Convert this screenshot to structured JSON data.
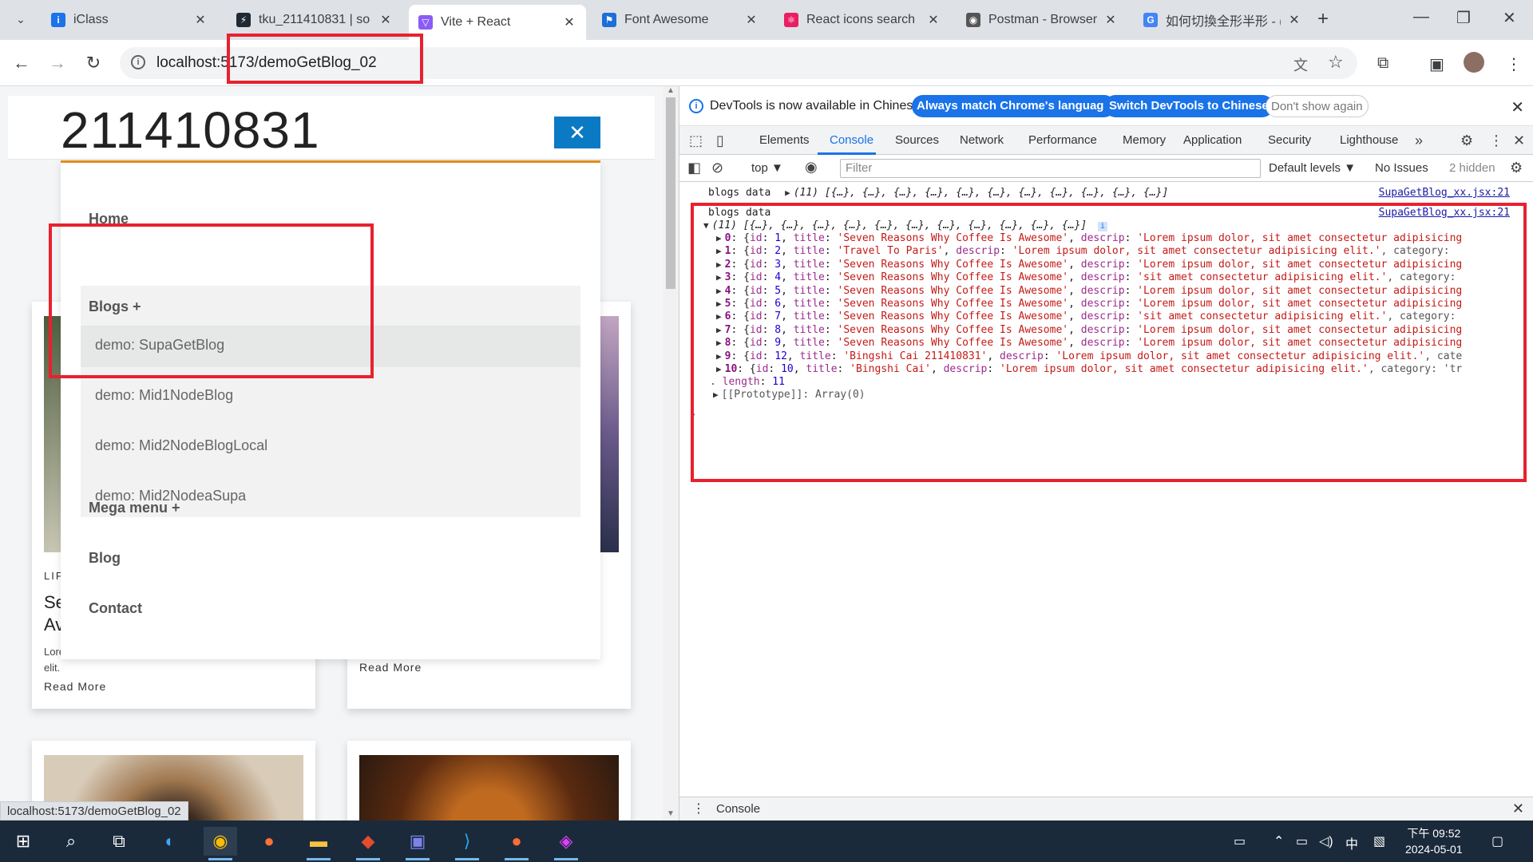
{
  "browser": {
    "tabs": [
      {
        "title": "iClass",
        "favicon_color": "#1a73e8",
        "favicon_char": "i",
        "active": false
      },
      {
        "title": "tku_211410831 | so",
        "favicon_color": "#1f2a33",
        "favicon_char": "⚡",
        "active": false
      },
      {
        "title": "Vite + React",
        "favicon_color": "#8a5cf6",
        "favicon_char": "▽",
        "active": true
      },
      {
        "title": "Font Awesome",
        "favicon_color": "#1d6fd6",
        "favicon_char": "⚑",
        "active": false
      },
      {
        "title": "React icons search",
        "favicon_color": "#e91e63",
        "favicon_char": "⚛",
        "active": false
      },
      {
        "title": "Postman - Browser",
        "favicon_color": "#555555",
        "favicon_char": "◉",
        "active": false
      },
      {
        "title": "如何切換全形半形 - (",
        "favicon_color": "#4285f4",
        "favicon_char": "G",
        "active": false
      }
    ],
    "new_tab_icon": "plus-icon",
    "url": "localhost:5173/demoGetBlog_02"
  },
  "page": {
    "site_title": "211410831",
    "close_symbol": "✕",
    "menu": {
      "items": [
        {
          "label": "Home"
        },
        {
          "label": "Blogs +"
        },
        {
          "label": "Mega menu +"
        },
        {
          "label": "Blog"
        },
        {
          "label": "Contact"
        }
      ],
      "blogs_submenu": [
        {
          "label": "demo: SupaGetBlog"
        },
        {
          "label": "demo: Mid1NodeBlog"
        },
        {
          "label": "demo: Mid2NodeBlogLocal"
        },
        {
          "label": "demo: Mid2NodeaSupa"
        }
      ]
    },
    "cards": [
      {
        "category": "LIF",
        "title_line1": "Se",
        "title_line2": "Av",
        "desc_line1": "Lore",
        "desc_line2": "elit.",
        "more": "Read More"
      },
      {
        "more": "Read More"
      }
    ],
    "status_url": "localhost:5173/demoGetBlog_02"
  },
  "devtools": {
    "banner": {
      "message": "DevTools is now available in Chinese!",
      "btn_match": "Always match Chrome's language",
      "btn_switch": "Switch DevTools to Chinese",
      "btn_dismiss": "Don't show again"
    },
    "tabs": [
      "Elements",
      "Console",
      "Sources",
      "Network",
      "Performance",
      "Memory",
      "Application",
      "Security",
      "Lighthouse"
    ],
    "active_tab": "Console",
    "context": "top",
    "filter_placeholder": "Filter",
    "levels": "Default levels",
    "issues": "No Issues",
    "hidden": "2 hidden",
    "console": {
      "collapsed_label": "blogs data",
      "collapsed_summary": "(11) [{…}, {…}, {…}, {…}, {…}, {…}, {…}, {…}, {…}, {…}, {…}]",
      "source": "SupaGetBlog_xx.jsx:21",
      "expanded_label": "blogs data",
      "expanded_summary": "(11) [{…}, {…}, {…}, {…}, {…}, {…}, {…}, {…}, {…}, {…}, {…}]",
      "rows": [
        {
          "index": "0",
          "id": "1",
          "title": "'Seven Reasons Why Coffee Is Awesome'",
          "descrip": "'Lorem ipsum dolor, sit amet consectetur adipisicing"
        },
        {
          "index": "1",
          "id": "2",
          "title": "'Travel To Paris'",
          "descrip": "'Lorem ipsum dolor, sit amet consectetur adipisicing elit.'",
          "tail": ", category:"
        },
        {
          "index": "2",
          "id": "3",
          "title": "'Seven Reasons Why Coffee Is Awesome'",
          "descrip": "'Lorem ipsum dolor, sit amet consectetur adipisicing"
        },
        {
          "index": "3",
          "id": "4",
          "title": "'Seven Reasons Why Coffee Is Awesome'",
          "descrip": "'sit amet consectetur adipisicing elit.'",
          "tail": ", category:"
        },
        {
          "index": "4",
          "id": "5",
          "title": "'Seven Reasons Why Coffee Is Awesome'",
          "descrip": "'Lorem ipsum dolor, sit amet consectetur adipisicing"
        },
        {
          "index": "5",
          "id": "6",
          "title": "'Seven Reasons Why Coffee Is Awesome'",
          "descrip": "'Lorem ipsum dolor, sit amet consectetur adipisicing"
        },
        {
          "index": "6",
          "id": "7",
          "title": "'Seven Reasons Why Coffee Is Awesome'",
          "descrip": "'sit amet consectetur adipisicing elit.'",
          "tail": ", category:"
        },
        {
          "index": "7",
          "id": "8",
          "title": "'Seven Reasons Why Coffee Is Awesome'",
          "descrip": "'Lorem ipsum dolor, sit amet consectetur adipisicing"
        },
        {
          "index": "8",
          "id": "9",
          "title": "'Seven Reasons Why Coffee Is Awesome'",
          "descrip": "'Lorem ipsum dolor, sit amet consectetur adipisicing"
        },
        {
          "index": "9",
          "id": "12",
          "title": "'Bingshi Cai 211410831'",
          "descrip": "'Lorem ipsum dolor, sit amet consectetur adipisicing elit.'",
          "tail": ", cate"
        },
        {
          "index": "10",
          "id": "10",
          "title": "'Bingshi Cai'",
          "descrip": "'Lorem ipsum dolor, sit amet consectetur adipisicing elit.'",
          "tail": ", category: 'tr"
        }
      ],
      "length_label": "length",
      "length_value": "11",
      "prototype": "[[Prototype]]: Array(0)"
    },
    "drawer_label": "Console"
  },
  "taskbar": {
    "time": "下午 09:52",
    "date": "2024-05-01",
    "ime": "中"
  }
}
